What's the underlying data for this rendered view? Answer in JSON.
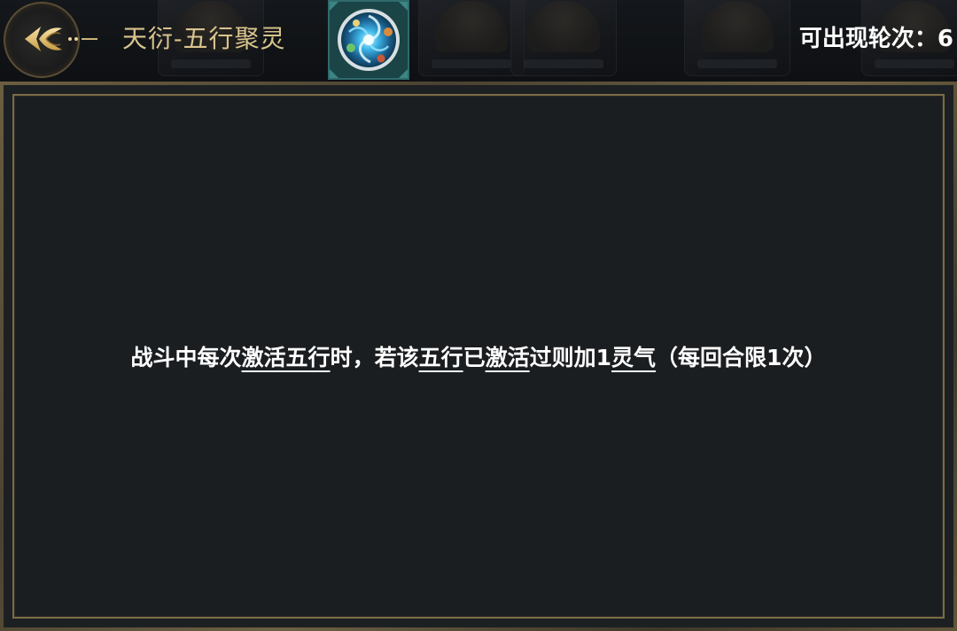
{
  "header": {
    "title": "天衍-五行聚灵",
    "round_label": "可出现轮次：6",
    "back_icon": "winged-arrow-back-icon",
    "skill_icon": "five-elements-swirl-icon"
  },
  "description": {
    "parts": [
      {
        "text": "战斗中每次",
        "keyword": false
      },
      {
        "text": "激活五行",
        "keyword": true
      },
      {
        "text": "时，若该",
        "keyword": false
      },
      {
        "text": "五行",
        "keyword": true
      },
      {
        "text": "已",
        "keyword": false
      },
      {
        "text": "激活",
        "keyword": true
      },
      {
        "text": "过则加1",
        "keyword": false
      },
      {
        "text": "灵气",
        "keyword": true
      },
      {
        "text": "（每回合限1次）",
        "keyword": false
      }
    ]
  },
  "colors": {
    "title_gold": "#d9c48d",
    "panel_bg": "#1b1e21",
    "frame_gold": "#7b6b47",
    "text": "#ffffff"
  }
}
